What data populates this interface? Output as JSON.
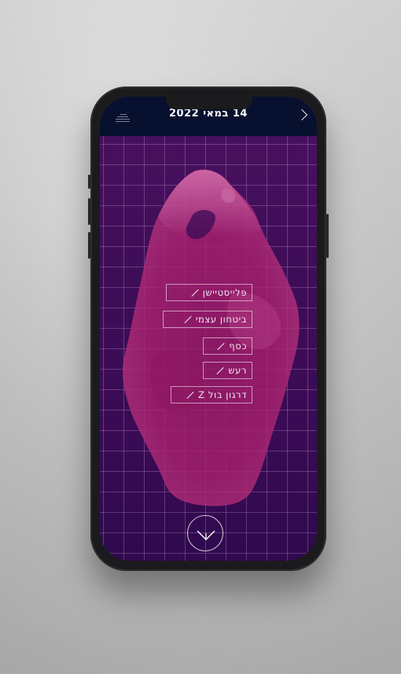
{
  "header": {
    "date_title": "14 במאי 2022"
  },
  "menu": {
    "items": [
      {
        "label": "פלייסטיישן"
      },
      {
        "label": "ביטחון עצמי"
      },
      {
        "label": "כסף"
      },
      {
        "label": "רעש"
      },
      {
        "label": "דרגון בול Z"
      }
    ]
  },
  "icons": {
    "logo": "logo-mark-icon",
    "forward": "chevron-right-icon",
    "scroll": "chevron-down-circle-icon"
  },
  "colors": {
    "screen_background": "#3e0d57",
    "header_background": "#07102e",
    "artwork_tint": "#a8206e",
    "grid_lines": "#e2aaeb"
  }
}
